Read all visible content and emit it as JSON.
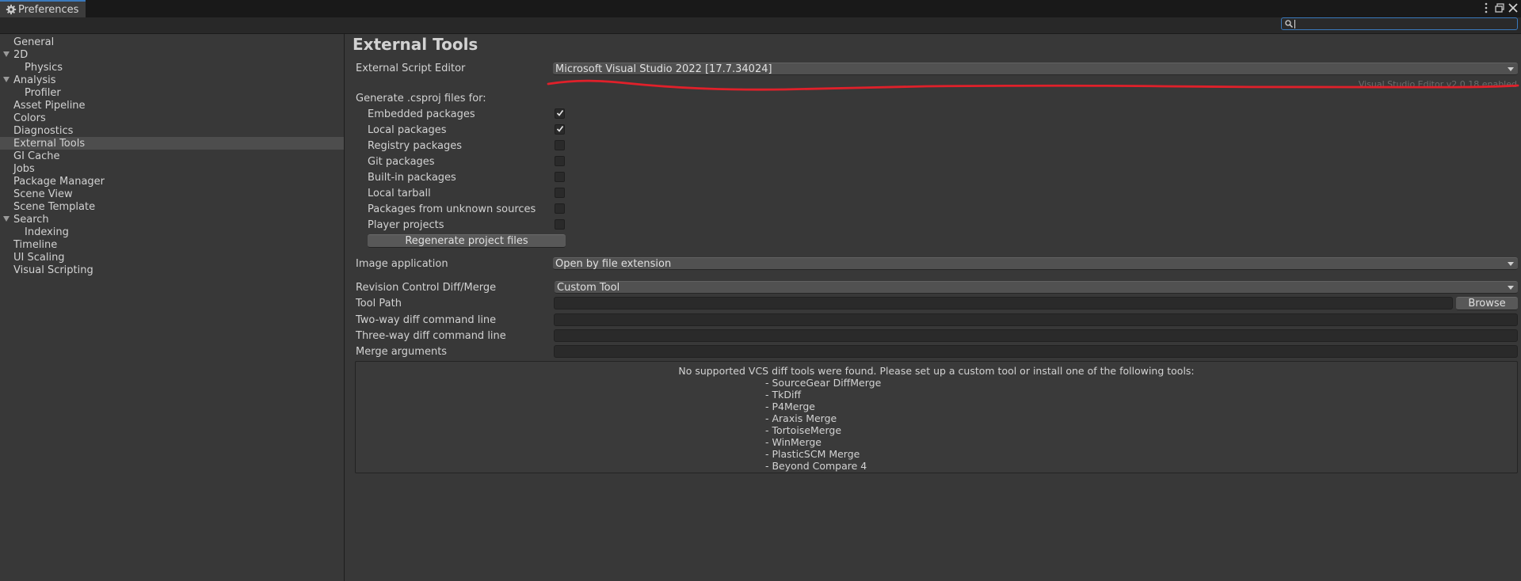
{
  "window": {
    "tab_title": "Preferences",
    "tab_icon": "gear-icon",
    "accent": "#3a79bb",
    "search": {
      "value": "",
      "icon": "search-icon"
    }
  },
  "sidebar": {
    "items": [
      {
        "label": "General"
      },
      {
        "label": "2D",
        "expanded": true
      },
      {
        "label": "Physics"
      },
      {
        "label": "Analysis",
        "expanded": true
      },
      {
        "label": "Profiler"
      },
      {
        "label": "Asset Pipeline"
      },
      {
        "label": "Colors"
      },
      {
        "label": "Diagnostics"
      },
      {
        "label": "External Tools",
        "selected": true
      },
      {
        "label": "GI Cache"
      },
      {
        "label": "Jobs"
      },
      {
        "label": "Package Manager"
      },
      {
        "label": "Scene View"
      },
      {
        "label": "Scene Template"
      },
      {
        "label": "Search",
        "expanded": true
      },
      {
        "label": "Indexing"
      },
      {
        "label": "Timeline"
      },
      {
        "label": "UI Scaling"
      },
      {
        "label": "Visual Scripting"
      }
    ]
  },
  "main": {
    "title": "External Tools",
    "script_editor": {
      "label": "External Script Editor",
      "value": "Microsoft Visual Studio 2022 [17.7.34024]",
      "status": "Visual Studio Editor v2.0.18 enabled",
      "annotation_color": "#e0202a"
    },
    "csproj": {
      "heading": "Generate .csproj files for:",
      "options": [
        {
          "label": "Embedded packages",
          "checked": true
        },
        {
          "label": "Local packages",
          "checked": true
        },
        {
          "label": "Registry packages",
          "checked": false
        },
        {
          "label": "Git packages",
          "checked": false
        },
        {
          "label": "Built-in packages",
          "checked": false
        },
        {
          "label": "Local tarball",
          "checked": false
        },
        {
          "label": "Packages from unknown sources",
          "checked": false
        },
        {
          "label": "Player projects",
          "checked": false
        }
      ],
      "regenerate_label": "Regenerate project files"
    },
    "image_app": {
      "label": "Image application",
      "value": "Open by file extension"
    },
    "revision": {
      "label": "Revision Control Diff/Merge",
      "value": "Custom Tool"
    },
    "tool_path": {
      "label": "Tool Path",
      "value": "",
      "browse_label": "Browse"
    },
    "two_way": {
      "label": "Two-way diff command line",
      "value": ""
    },
    "three_way": {
      "label": "Three-way diff command line",
      "value": ""
    },
    "merge_args": {
      "label": "Merge arguments",
      "value": ""
    },
    "help": {
      "message": "No supported VCS diff tools were found. Please set up a custom tool or install one of the following tools:",
      "tools": [
        "- SourceGear DiffMerge",
        "- TkDiff",
        "- P4Merge",
        "- Araxis Merge",
        "- TortoiseMerge",
        "- WinMerge",
        "- PlasticSCM Merge",
        "- Beyond Compare 4"
      ]
    }
  }
}
